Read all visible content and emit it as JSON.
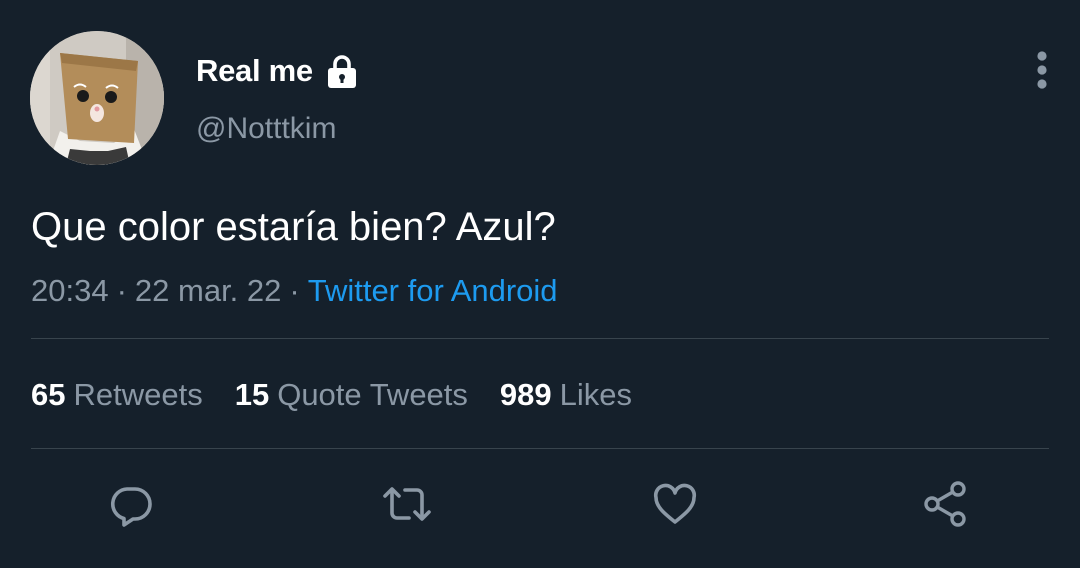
{
  "author": {
    "display_name": "Real me",
    "handle": "@Notttkim",
    "protected": true,
    "avatar_icon": "cat-with-paper-bag-avatar"
  },
  "tweet": {
    "text": "Que color estaría bien? Azul?",
    "time": "20:34",
    "date": "22 mar. 22",
    "separator": "·",
    "source": "Twitter for Android"
  },
  "stats": {
    "retweets": {
      "count": "65",
      "label": "Retweets"
    },
    "quote_tweets": {
      "count": "15",
      "label": "Quote Tweets"
    },
    "likes": {
      "count": "989",
      "label": "Likes"
    }
  },
  "actions": [
    {
      "icon": "reply-icon"
    },
    {
      "icon": "retweet-icon"
    },
    {
      "icon": "like-icon"
    },
    {
      "icon": "share-icon"
    }
  ],
  "colors": {
    "background": "#15202b",
    "text_primary": "#ffffff",
    "text_secondary": "#8b98a5",
    "link": "#1d9bf0",
    "divider": "#38444d"
  }
}
